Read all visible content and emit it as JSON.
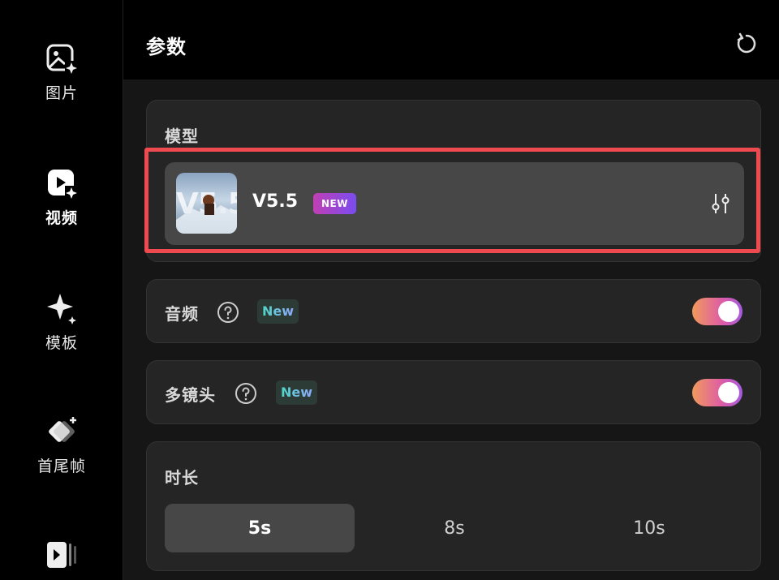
{
  "sidebar": {
    "items": [
      {
        "label": "图片",
        "icon": "image-sparkle-icon",
        "active": false
      },
      {
        "label": "视频",
        "icon": "video-sparkle-icon",
        "active": true
      },
      {
        "label": "模板",
        "icon": "sparkle-icon",
        "active": false
      },
      {
        "label": "首尾帧",
        "icon": "frames-icon",
        "active": false
      },
      {
        "label": "",
        "icon": "video-frames-icon",
        "active": false
      }
    ]
  },
  "header": {
    "title": "参数",
    "reset_icon": "reset-icon"
  },
  "model": {
    "section_label": "模型",
    "thumbnail_text": "V5.5",
    "name": "V5.5",
    "badge": "NEW"
  },
  "audio": {
    "label": "音频",
    "badge": "New",
    "enabled": true
  },
  "multi_shot": {
    "label": "多镜头",
    "badge": "New",
    "enabled": true
  },
  "duration": {
    "label": "时长",
    "options": [
      "5s",
      "8s",
      "10s"
    ],
    "selected": "5s"
  },
  "colors": {
    "highlight": "#ef4a4f",
    "toggle_gradient": [
      "#f29a5b",
      "#dd5ba8",
      "#a55be0"
    ],
    "badge_gradient": [
      "#c13fb3",
      "#7a4cf0"
    ]
  }
}
